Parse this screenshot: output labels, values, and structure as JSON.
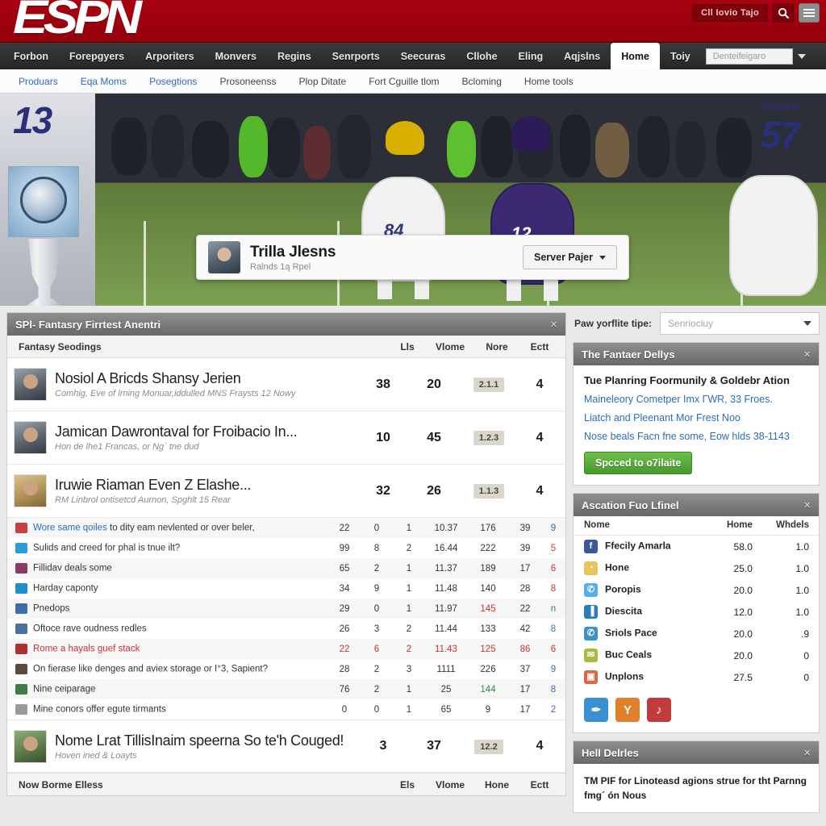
{
  "header": {
    "logo": "ESPN",
    "top_pill": "Cll Iovio Tajo",
    "search_icon": "search-icon",
    "menu_icon": "hamburger-icon"
  },
  "nav": {
    "items": [
      {
        "label": "Forbon",
        "active": false
      },
      {
        "label": "Forepgyers",
        "active": false
      },
      {
        "label": "Arporiters",
        "active": false
      },
      {
        "label": "Monvers",
        "active": false
      },
      {
        "label": "Regins",
        "active": false
      },
      {
        "label": "Senrports",
        "active": false
      },
      {
        "label": "Seecuras",
        "active": false
      },
      {
        "label": "Cllohe",
        "active": false
      },
      {
        "label": "Eling",
        "active": false
      },
      {
        "label": "Aqjslns",
        "active": false
      },
      {
        "label": "Home",
        "active": true
      },
      {
        "label": "Toiy",
        "active": false
      }
    ],
    "select_placeholder": "Denteifeigaro"
  },
  "subnav": {
    "items": [
      {
        "label": "Produars",
        "link": true
      },
      {
        "label": "Eqa Moms",
        "link": true
      },
      {
        "label": "Posegtions",
        "link": true
      },
      {
        "label": "Prosoneenss",
        "link": false
      },
      {
        "label": "Plop Ditate",
        "link": false
      },
      {
        "label": "Fort Cguille tlom",
        "link": false
      },
      {
        "label": "Bcloming",
        "link": false
      },
      {
        "label": "Home tools",
        "link": false
      }
    ]
  },
  "hero": {
    "left_jersey_number": "13",
    "right_jersey_number": "57",
    "right_jersey_name": "CONNSAY",
    "field_player_white": "84",
    "field_player_purple": "12",
    "profile": {
      "name": "Trilla Jlesns",
      "subtitle": "Ralnds 1ą Rpel",
      "button": "Server Pajer"
    }
  },
  "main_panel": {
    "title": "SPl- Fantasry Firrtest Anentri",
    "close": "×",
    "table_header": {
      "label": "Fantasy Seodings",
      "cols": [
        "Lls",
        "Vlome",
        "Nore",
        "Ectt"
      ]
    },
    "footer_header": {
      "label": "Now Borme Elless",
      "cols": [
        "Els",
        "Vlome",
        "Hone",
        "Ectt"
      ]
    },
    "big_rows": [
      {
        "avatar": "dark",
        "title": "Nosiol A Bricds Shansy Jerien",
        "subtitle": "Comhig, Eve of lrning Monuar,iddulled MNS Fraysts 12 Nowy",
        "c1": "38",
        "c2": "20",
        "badge": "2.1.1",
        "c4": "4"
      },
      {
        "avatar": "dark",
        "title": "Jamican Dawrontaval for Froibacio In...",
        "subtitle": "Hon de lhe1 Francas, or Ngˈ tne dud",
        "c1": "10",
        "c2": "45",
        "badge": "1.2.3",
        "c4": "4"
      },
      {
        "avatar": "tan",
        "title": "Iruwie Riaman Even Z Elashe...",
        "subtitle": "RM Linbrol ontisetcd Aurnon, Spghlt 15 Rear",
        "c1": "32",
        "c2": "26",
        "badge": "1.1.3",
        "c4": "4"
      }
    ],
    "bottom_row": {
      "avatar": "green",
      "title": "Nome Lrat TillisInaim speerna So te'h Couged!",
      "subtitle": "Hoven ined & Loayts",
      "c1": "3",
      "c2": "37",
      "badge": "12.2",
      "c4": "4"
    },
    "dense_rows": [
      {
        "icon_color": "#c94040",
        "name": "Wore same qoiles to dity eam nevlented or over beler,",
        "link_words": "Wore same qoiles",
        "v1": "22",
        "v2": "0",
        "v3": "1",
        "v4": "10.37",
        "v5": "176",
        "v6": "39",
        "v7": "9",
        "style": "normal",
        "v7style": "b"
      },
      {
        "icon_color": "#2a9fd6",
        "name": "Sulids and creed for phal is tnue ilt?",
        "link_words": "",
        "v1": "99",
        "v2": "8",
        "v3": "2",
        "v4": "16.44",
        "v5": "222",
        "v6": "39",
        "v7": "5",
        "style": "normal",
        "v7style": "r"
      },
      {
        "icon_color": "#8c3a6b",
        "name": "Fillidav deals some",
        "link_words": "",
        "v1": "65",
        "v2": "2",
        "v3": "1",
        "v4": "11.37",
        "v5": "189",
        "v6": "17",
        "v7": "6",
        "style": "normal",
        "v7style": "r"
      },
      {
        "icon_color": "#1f8ecd",
        "name": "Harday caponty",
        "link_words": "",
        "v1": "34",
        "v2": "9",
        "v3": "1",
        "v4": "11.48",
        "v5": "140",
        "v6": "28",
        "v7": "8",
        "style": "normal",
        "v7style": "r"
      },
      {
        "icon_color": "#3b6ea8",
        "name": "Pnedops",
        "link_words": "",
        "v1": "29",
        "v2": "0",
        "v3": "1",
        "v4": "11.97",
        "v5": "145",
        "v6": "22",
        "v7": "n",
        "style": "normal",
        "v5style": "r",
        "v7style": "g"
      },
      {
        "icon_color": "#4a6fa5",
        "name": "Oftoce rave oudness redles",
        "link_words": "",
        "v1": "26",
        "v2": "3",
        "v3": "2",
        "v4": "11.44",
        "v5": "133",
        "v6": "42",
        "v7": "8",
        "style": "normal",
        "v7style": "b"
      },
      {
        "icon_color": "#b03030",
        "name": "Rome a hayals guef stack",
        "link_words": "",
        "v1": "22",
        "v2": "6",
        "v3": "2",
        "v4": "11.43",
        "v5": "125",
        "v6": "86",
        "v7": "6",
        "style": "red",
        "v7style": "r"
      },
      {
        "icon_color": "#5c4a3a",
        "name": "On fierase like denges and aviex storage or I°3, Sapient?",
        "link_words": "",
        "v1": "28",
        "v2": "2",
        "v3": "3",
        "v4": "1111",
        "v5": "226",
        "v6": "37",
        "v7": "9",
        "style": "normal",
        "v7style": "b"
      },
      {
        "icon_color": "#3f7a4a",
        "name": "Nine ceiparage",
        "link_words": "",
        "v1": "76",
        "v2": "2",
        "v3": "1",
        "v4": "25",
        "v5": "144",
        "v6": "17",
        "v7": "8",
        "style": "normal",
        "v5style": "g",
        "v7style": "b"
      },
      {
        "icon_color": "#9a9a9a",
        "name": "Mine conors offer egute tirmants",
        "link_words": "",
        "v1": "0",
        "v2": "0",
        "v3": "1",
        "v4": "65",
        "v5": "9",
        "v6": "17",
        "v7": "2",
        "style": "normal",
        "v7style": "b"
      }
    ]
  },
  "sidebar": {
    "selector": {
      "label": "Paw yorflite tipe:",
      "value": "Senriocluy"
    },
    "panel_fantaer": {
      "title": "The Fantaer Dellys",
      "close": "×",
      "heading": "Tue Planring Foormunily & Goldebr Ation",
      "links": [
        "Maineleory Cometper Imx ГWR, 33 Froes.",
        "Liatch and Pleenant Mor Frest Noo",
        "Nose beals Facn fne some, Eow hlds 38-1143"
      ],
      "button": "Spcced to o7ilaite"
    },
    "panel_accation": {
      "title": "Ascation Fuo Lfinel",
      "close": "×",
      "cols": [
        "Nome",
        "Home",
        "Whdels"
      ],
      "rows": [
        {
          "icon_color": "#3b5998",
          "glyph": "f",
          "name": "Ffecily Amarla",
          "home": "58.0",
          "wheels": "1.0"
        },
        {
          "icon_color": "#e8c55a",
          "glyph": "◔",
          "name": "Hone",
          "home": "25.0",
          "wheels": "1.0"
        },
        {
          "icon_color": "#55acee",
          "glyph": "✆",
          "name": "Poropis",
          "home": "20.0",
          "wheels": "1.0"
        },
        {
          "icon_color": "#2b7cb8",
          "glyph": "▐",
          "name": "Diescita",
          "home": "12.0",
          "wheels": "1.0"
        },
        {
          "icon_color": "#3a93c4",
          "glyph": "✆",
          "name": "Sriols Pace",
          "home": "20.0",
          "wheels": ".9"
        },
        {
          "icon_color": "#a8bd3f",
          "glyph": "✉",
          "name": "Buc Ceals",
          "home": "20.0",
          "wheels": "0"
        },
        {
          "icon_color": "#dd6644",
          "glyph": "▣",
          "name": "Unplons",
          "home": "27.5",
          "wheels": "0"
        }
      ],
      "social": [
        {
          "name": "twitter-share-button",
          "color": "#3a8fd0",
          "glyph": "✒"
        },
        {
          "name": "yahoo-share-button",
          "color": "#e08028",
          "glyph": "Y"
        },
        {
          "name": "rss-share-button",
          "color": "#c23b3b",
          "glyph": "♪"
        }
      ]
    },
    "panel_hell": {
      "title": "Hell Delrles",
      "close": "×",
      "text": "TM PIF for Linoteasd agions strue for tht Parnng fmg´ ón Nous"
    }
  }
}
